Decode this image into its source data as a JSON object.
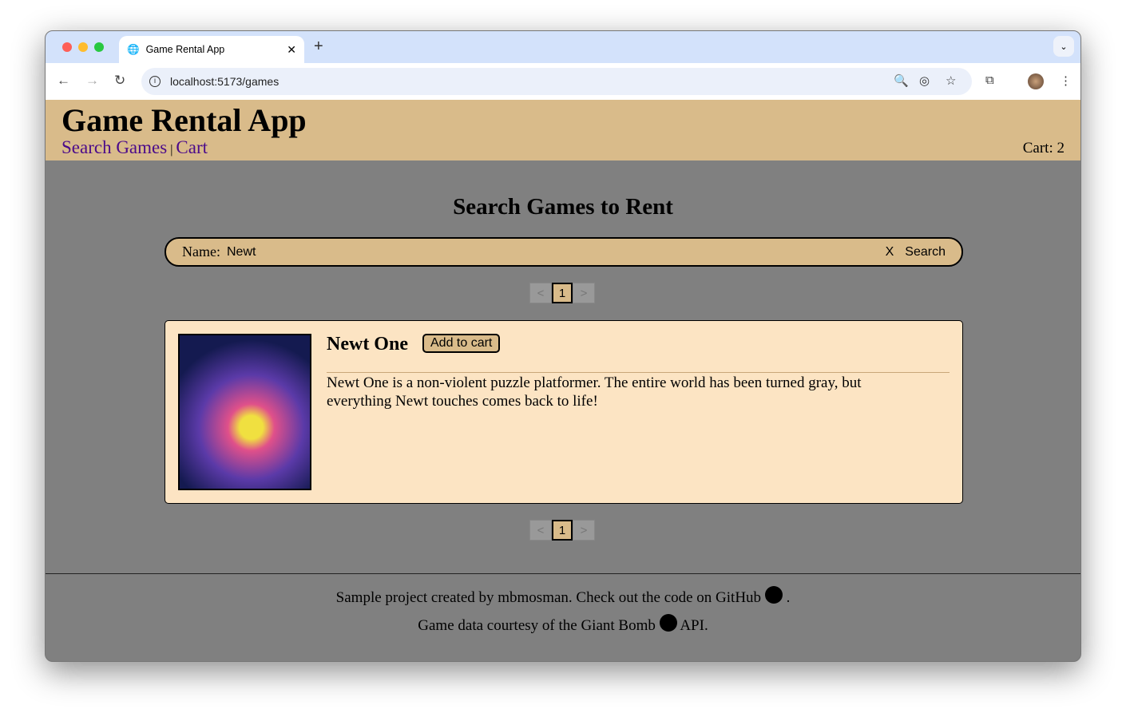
{
  "browser": {
    "tab_title": "Game Rental App",
    "url": "localhost:5173/games"
  },
  "header": {
    "title": "Game Rental App",
    "nav": [
      "Search Games",
      "Cart"
    ],
    "separator": "|",
    "cart": "Cart: 2"
  },
  "main": {
    "heading": "Search Games to Rent",
    "search": {
      "label": "Name:",
      "value": "Newt",
      "clear": "X",
      "button": "Search"
    },
    "pager": {
      "prev": "<",
      "current": "1",
      "next": ">"
    },
    "results": [
      {
        "title": "Newt One",
        "cover_text": "Newt One",
        "add_label": "Add to cart",
        "description": "Newt One is a non-violent puzzle platformer. The entire world has been turned gray, but everything Newt touches comes back to life!"
      }
    ]
  },
  "footer": {
    "line1": "Sample project created by mbmosman. Check out the code on GitHub",
    "line1_end": ".",
    "line2": "Game data courtesy of the Giant Bomb",
    "line2_end": "API."
  }
}
